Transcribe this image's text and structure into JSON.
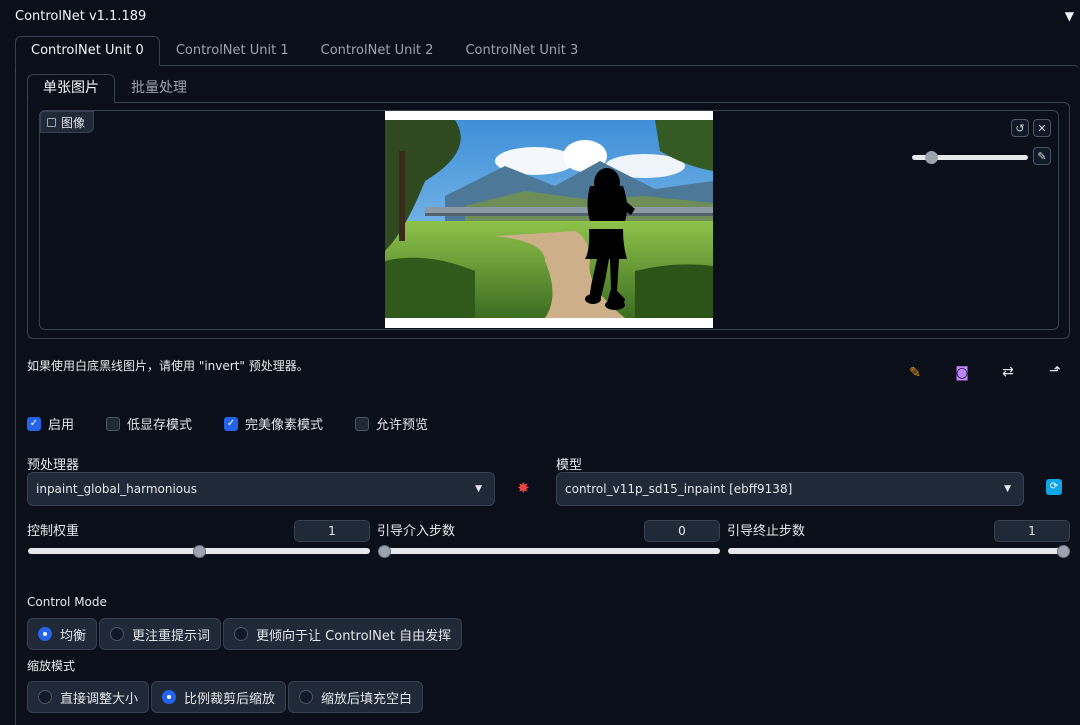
{
  "panel": {
    "title": "ControlNet v1.1.189",
    "collapse_icon": "▼"
  },
  "unit_tabs": [
    "ControlNet Unit 0",
    "ControlNet Unit 1",
    "ControlNet Unit 2",
    "ControlNet Unit 3"
  ],
  "sub_tabs": [
    "单张图片",
    "批量处理"
  ],
  "image": {
    "label": "图像"
  },
  "hint": "如果使用白底黑线图片，请使用 \"invert\" 预处理器。",
  "checkboxes": [
    {
      "label": "启用",
      "checked": true
    },
    {
      "label": "低显存模式",
      "checked": false
    },
    {
      "label": "完美像素模式",
      "checked": true
    },
    {
      "label": "允许预览",
      "checked": false
    }
  ],
  "preprocessor": {
    "label": "预处理器",
    "value": "inpaint_global_harmonious"
  },
  "model": {
    "label": "模型",
    "value": "control_v11p_sd15_inpaint [ebff9138]"
  },
  "sliders": {
    "weight": {
      "label": "控制权重",
      "value": "1",
      "fraction": 0.5
    },
    "start": {
      "label": "引导介入步数",
      "value": "0",
      "fraction": 0.0
    },
    "end": {
      "label": "引导终止步数",
      "value": "1",
      "fraction": 1.0
    }
  },
  "control_mode": {
    "label": "Control Mode",
    "options": [
      "均衡",
      "更注重提示词",
      "更倾向于让 ControlNet 自由发挥"
    ],
    "selected": 0
  },
  "resize_mode": {
    "label": "缩放模式",
    "options": [
      "直接调整大小",
      "比例裁剪后缩放",
      "缩放后填充空白"
    ],
    "selected": 1
  },
  "colors": {
    "accent": "#2563eb",
    "background": "#0b0f19",
    "border": "#374151"
  }
}
